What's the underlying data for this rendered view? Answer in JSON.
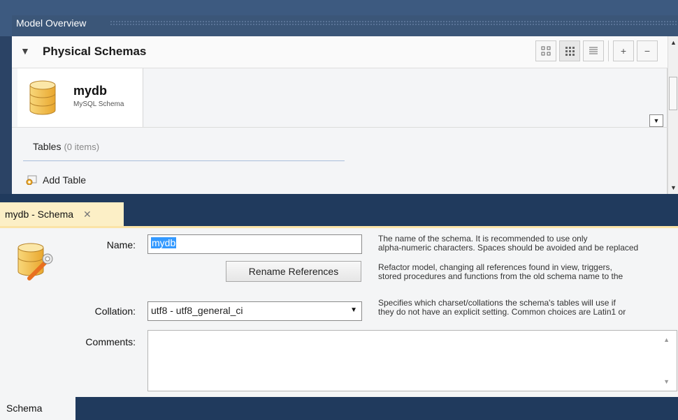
{
  "header": {
    "title": "Model Overview"
  },
  "section": {
    "title": "Physical Schemas"
  },
  "toolbar": {
    "add": "+",
    "remove": "−"
  },
  "schema_tab": {
    "name": "mydb",
    "subtitle": "MySQL Schema"
  },
  "tables": {
    "label": "Tables",
    "count": "(0 items)",
    "add_label": "Add Table"
  },
  "editor": {
    "tab_label": "mydb - Schema",
    "name_label": "Name:",
    "name_value": "mydb",
    "rename_button": "Rename References",
    "collation_label": "Collation:",
    "collation_value": "utf8 - utf8_general_ci",
    "comments_label": "Comments:",
    "help_name_1": "The name of the schema. It is recommended to use only",
    "help_name_2": "alpha-numeric characters. Spaces should be avoided and be replaced",
    "help_rename_1": "Refactor model, changing all references found in view, triggers,",
    "help_rename_2": "stored procedures and functions from the old schema name to the",
    "help_collation_1": "Specifies which charset/collations the schema's tables will use if",
    "help_collation_2": "they do not have an explicit setting. Common choices are Latin1 or"
  },
  "bottom": {
    "tab_label": "Schema"
  },
  "colors": {
    "frame": "#203a5d",
    "header": "#3b5678",
    "tab_active": "#fcefc6",
    "selection": "#3399ff"
  }
}
